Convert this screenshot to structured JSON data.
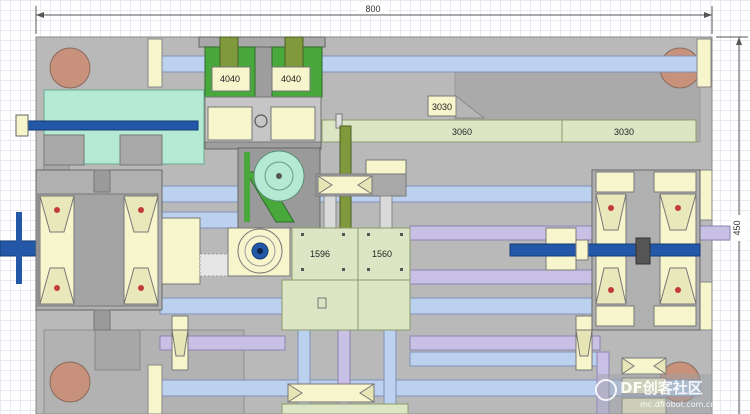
{
  "dimensions": {
    "width": "800",
    "height": "450"
  },
  "labels": {
    "profile_4040_left": "4040",
    "profile_4040_right": "4040",
    "profile_3030_top": "3030",
    "profile_3060": "3060",
    "profile_3030_right": "3030",
    "profile_1596": "1596",
    "profile_1560": "1560"
  },
  "watermark": {
    "text": "DF创客社区",
    "sub": "mc.dfrobot.com.cn"
  },
  "colors": {
    "base": "#b8b8b8",
    "rail_blue": "#bcd0ef",
    "rail_purple": "#c9c0e6",
    "pale_yellow": "#f6f5cc",
    "green": "#49a83c",
    "olive": "#7f993c",
    "shaft_blue": "#2358a8",
    "cyan_block": "#b4ead4",
    "foot_pad": "#c7907a"
  }
}
